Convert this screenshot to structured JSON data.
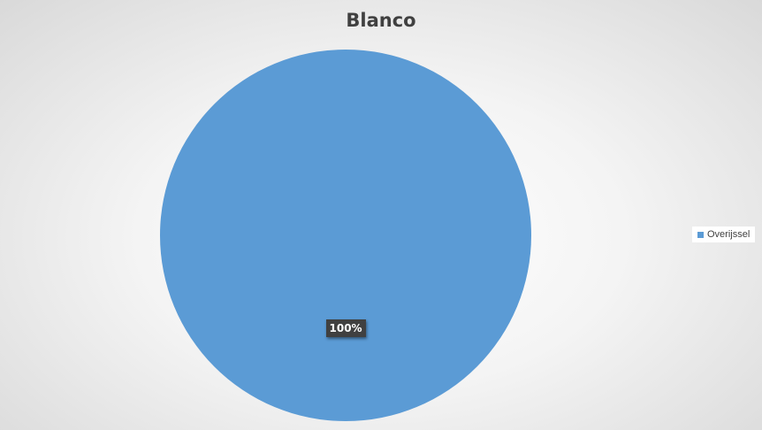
{
  "chart_data": {
    "type": "pie",
    "title": "Blanco",
    "categories": [
      "Overijssel"
    ],
    "values": [
      100
    ],
    "data_labels": [
      "100%"
    ],
    "colors": [
      "#5b9bd5"
    ],
    "legend": {
      "position": "right",
      "entries": [
        "Overijssel"
      ]
    }
  }
}
